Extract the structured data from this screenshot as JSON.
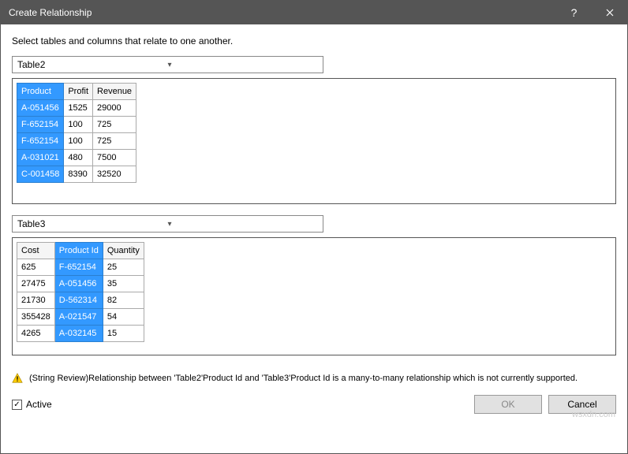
{
  "title": "Create Relationship",
  "instruction": "Select tables and columns that relate to one another.",
  "table1_name": "Table2",
  "table2_name": "Table3",
  "table1": {
    "columns": [
      "Product",
      "Profit",
      "Revenue"
    ],
    "selected_col": 0,
    "rows": [
      [
        "A-051456",
        "1525",
        "29000"
      ],
      [
        "F-652154",
        "100",
        "725"
      ],
      [
        "F-652154",
        "100",
        "725"
      ],
      [
        "A-031021",
        "480",
        "7500"
      ],
      [
        "C-001458",
        "8390",
        "32520"
      ]
    ]
  },
  "table2": {
    "columns": [
      "Cost",
      "Product Id",
      "Quantity"
    ],
    "selected_col": 1,
    "rows": [
      [
        "625",
        "F-652154",
        "25"
      ],
      [
        "27475",
        "A-051456",
        "35"
      ],
      [
        "21730",
        "D-562314",
        "82"
      ],
      [
        "355428",
        "A-021547",
        "54"
      ],
      [
        "4265",
        "A-032145",
        "15"
      ]
    ]
  },
  "warning": "(String Review)Relationship between 'Table2'Product Id and 'Table3'Product Id is a many-to-many relationship which is not currently supported.",
  "active_label": "Active",
  "active_checked": true,
  "ok_label": "OK",
  "cancel_label": "Cancel",
  "watermark": "wsxdn.com"
}
